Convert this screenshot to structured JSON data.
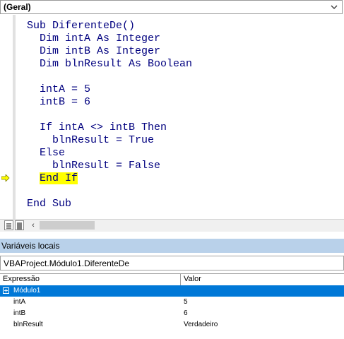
{
  "object_combo": {
    "value": "(Geral)",
    "arrow_icon": "chevron-down-icon"
  },
  "code": {
    "lines": [
      "Sub DiferenteDe()",
      "  Dim intA As Integer",
      "  Dim intB As Integer",
      "  Dim blnResult As Boolean",
      "",
      "  intA = 5",
      "  intB = 6",
      "",
      "  If intA <> intB Then",
      "    blnResult = True",
      "  Else",
      "    blnResult = False",
      "  End If",
      "",
      "End Sub"
    ],
    "current_line": "End If",
    "execution_pointer_icon": "arrow-right-icon",
    "highlight_color": "#ffff00"
  },
  "locals": {
    "title": "Variáveis locais",
    "context": "VBAProject.Módulo1.DiferenteDe",
    "columns": {
      "expression": "Expressão",
      "value": "Valor"
    },
    "rows": [
      {
        "expression": "Módulo1",
        "value": "",
        "selected": true
      },
      {
        "expression": "intA",
        "value": "5"
      },
      {
        "expression": "intB",
        "value": "6"
      },
      {
        "expression": "blnResult",
        "value": "Verdadeiro"
      }
    ],
    "selection_color": "#0078d7"
  }
}
